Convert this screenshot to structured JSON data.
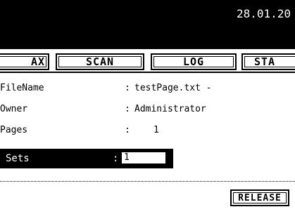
{
  "header": {
    "datetime": "28.01.20"
  },
  "tabs": {
    "left_partial": "AX",
    "scan": "SCAN",
    "log": "LOG",
    "right_partial": "STA"
  },
  "job": {
    "file_label": "FileName",
    "file_value": "testPage.txt -",
    "owner_label": "Owner",
    "owner_value": "Administrator",
    "pages_label": "Pages",
    "pages_value": "1",
    "colon": ":"
  },
  "sets": {
    "label": "Sets",
    "colon": ":",
    "value": "1"
  },
  "buttons": {
    "release": "RELEASE"
  }
}
